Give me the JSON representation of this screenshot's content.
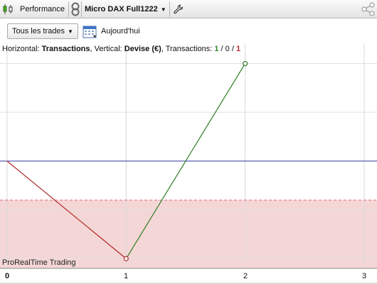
{
  "toolbar": {
    "performance_label": "Performance",
    "system_name": "Micro DAX Full1222",
    "icons": [
      "candles-icon",
      "link-icon",
      "wrench-icon",
      "share-icon"
    ]
  },
  "filters": {
    "trades_dropdown": "Tous les trades",
    "date_label": "Aujourd'hui"
  },
  "chart_info": {
    "horizontal_prefix": "Horizontal: ",
    "horizontal_value": "Transactions",
    "vertical_prefix": ", Vertical: ",
    "vertical_value": "Devise (€)",
    "transactions_prefix": ", Transactions: ",
    "wins": "1",
    "sep1": " / ",
    "neutral": "0",
    "sep2": " / ",
    "losses": "1"
  },
  "watermark": "ProRealTime Trading",
  "colors": {
    "loss_line": "#b02a2a",
    "gain_line": "#2e7d22",
    "zero_line": "#3a3aa8",
    "negative_zone": "#f5d6d6",
    "negative_zone_border": "#e06a6a"
  },
  "chart_data": {
    "type": "line",
    "x": [
      0,
      1,
      2
    ],
    "y": [
      0,
      -1,
      1
    ],
    "point_colors": [
      "#b02a2a",
      "#b02a2a",
      "#2e7d22"
    ],
    "xticks": [
      "0",
      "1",
      "2",
      "3"
    ],
    "xlim": [
      0,
      3
    ],
    "ylim": [
      -1.1,
      1.2
    ],
    "negative_zone_top": -0.4,
    "grid": true
  }
}
